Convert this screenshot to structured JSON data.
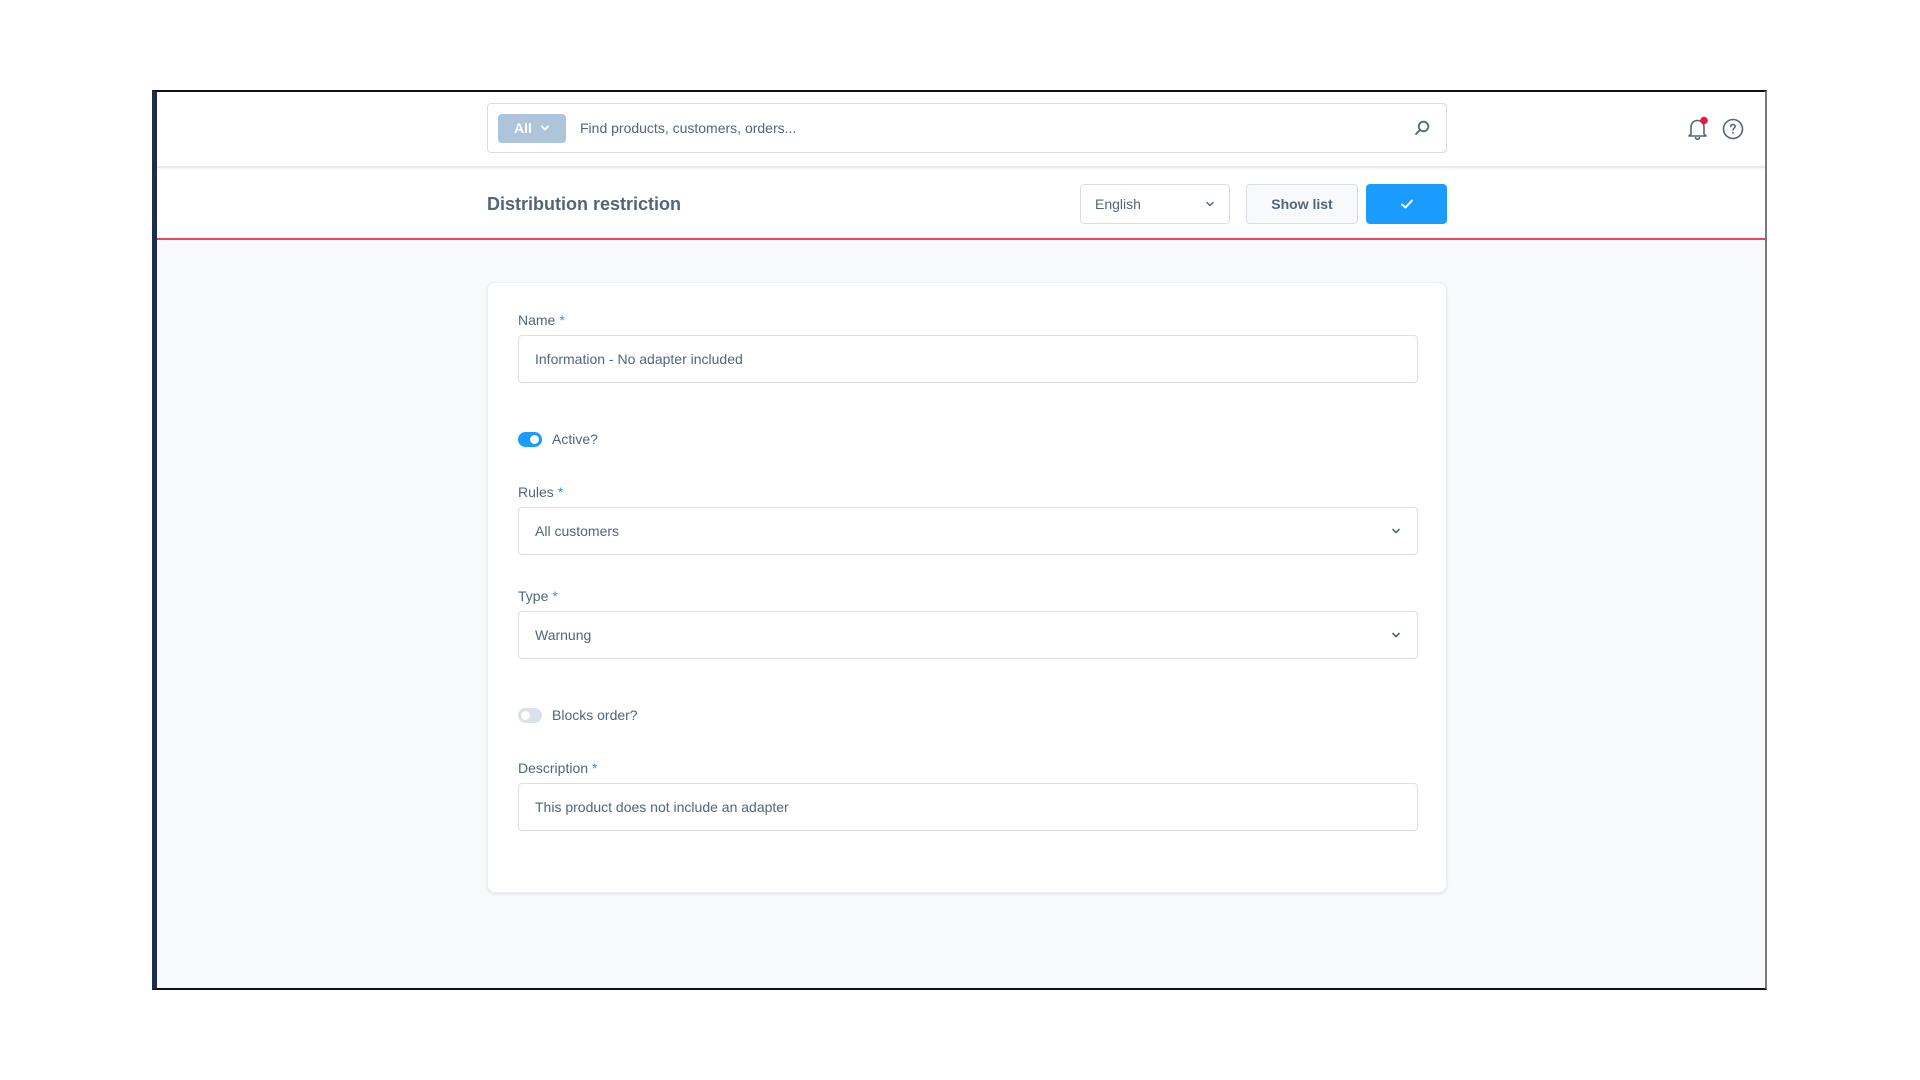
{
  "topbar": {
    "search": {
      "type_filter": "All",
      "placeholder": "Find products, customers, orders...",
      "value": ""
    },
    "icons": {
      "notifications": "bell-icon",
      "notification_badge_color": "#e8193c",
      "help": "help-circle-icon",
      "search": "search-icon"
    }
  },
  "toolbar": {
    "title": "Distribution restriction",
    "language": "English",
    "show_list_label": "Show list",
    "save_icon": "check-icon",
    "accent_color": "#1a9cff",
    "divider_color": "#f0445e"
  },
  "form": {
    "name": {
      "label": "Name",
      "required": "*",
      "value": "Information - No adapter included"
    },
    "active": {
      "label": "Active?",
      "checked": true
    },
    "rules": {
      "label": "Rules",
      "required": "*",
      "value": "All customers"
    },
    "type": {
      "label": "Type",
      "required": "*",
      "value": "Warnung"
    },
    "blocks_order": {
      "label": "Blocks order?",
      "checked": false
    },
    "description": {
      "label": "Description",
      "required": "*",
      "value": "This product does not include an adapter"
    }
  }
}
